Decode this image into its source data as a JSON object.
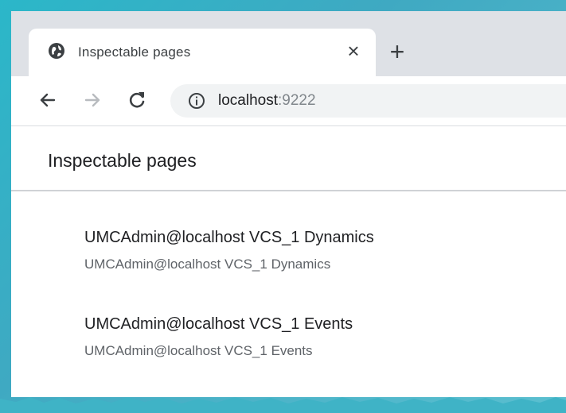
{
  "tab": {
    "title": "Inspectable pages",
    "close_glyph": "×",
    "icon": "globe-icon"
  },
  "new_tab": {
    "glyph": "+"
  },
  "toolbar": {
    "back_icon": "back-arrow-icon",
    "forward_icon": "forward-arrow-icon",
    "reload_icon": "reload-icon",
    "url_host": "localhost",
    "url_port": ":9222",
    "security_icon": "info-icon"
  },
  "page": {
    "title": "Inspectable pages",
    "targets": [
      {
        "name": "UMCAdmin@localhost VCS_1 Dynamics",
        "subtitle": "UMCAdmin@localhost VCS_1 Dynamics"
      },
      {
        "name": "UMCAdmin@localhost VCS_1 Events",
        "subtitle": "UMCAdmin@localhost VCS_1 Events"
      }
    ]
  },
  "colors": {
    "background_accent": "#2bb7c9",
    "tabstrip": "#dee1e6",
    "omnibox": "#f1f3f4",
    "text_primary": "#202124",
    "text_secondary": "#5f6368"
  }
}
